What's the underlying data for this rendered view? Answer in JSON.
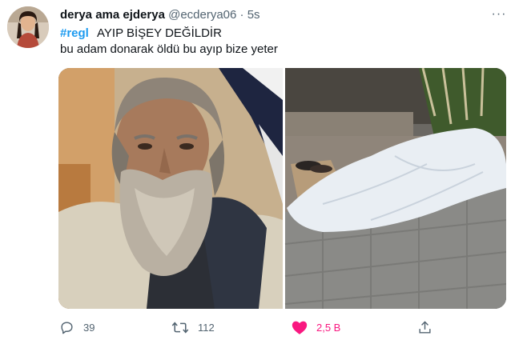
{
  "tweet": {
    "author_name": "derya ama ejderya",
    "author_handle": "@ecderya06",
    "separator": "·",
    "time": "5s",
    "hashtag": "#regl",
    "text_line1": "AYIP BİŞEY DEĞİLDİR",
    "text_line2": "bu adam donarak öldü bu ayıp bize yeter",
    "more_label": "···"
  },
  "actions": {
    "replies": "39",
    "retweets": "112",
    "likes": "2,5 B"
  },
  "icons": {
    "reply": "reply-icon",
    "retweet": "retweet-icon",
    "like": "heart-icon",
    "share": "share-icon",
    "more": "more-icon"
  },
  "colors": {
    "hashtag": "#1d9bf0",
    "like_active": "#f91880",
    "muted": "#536471"
  }
}
